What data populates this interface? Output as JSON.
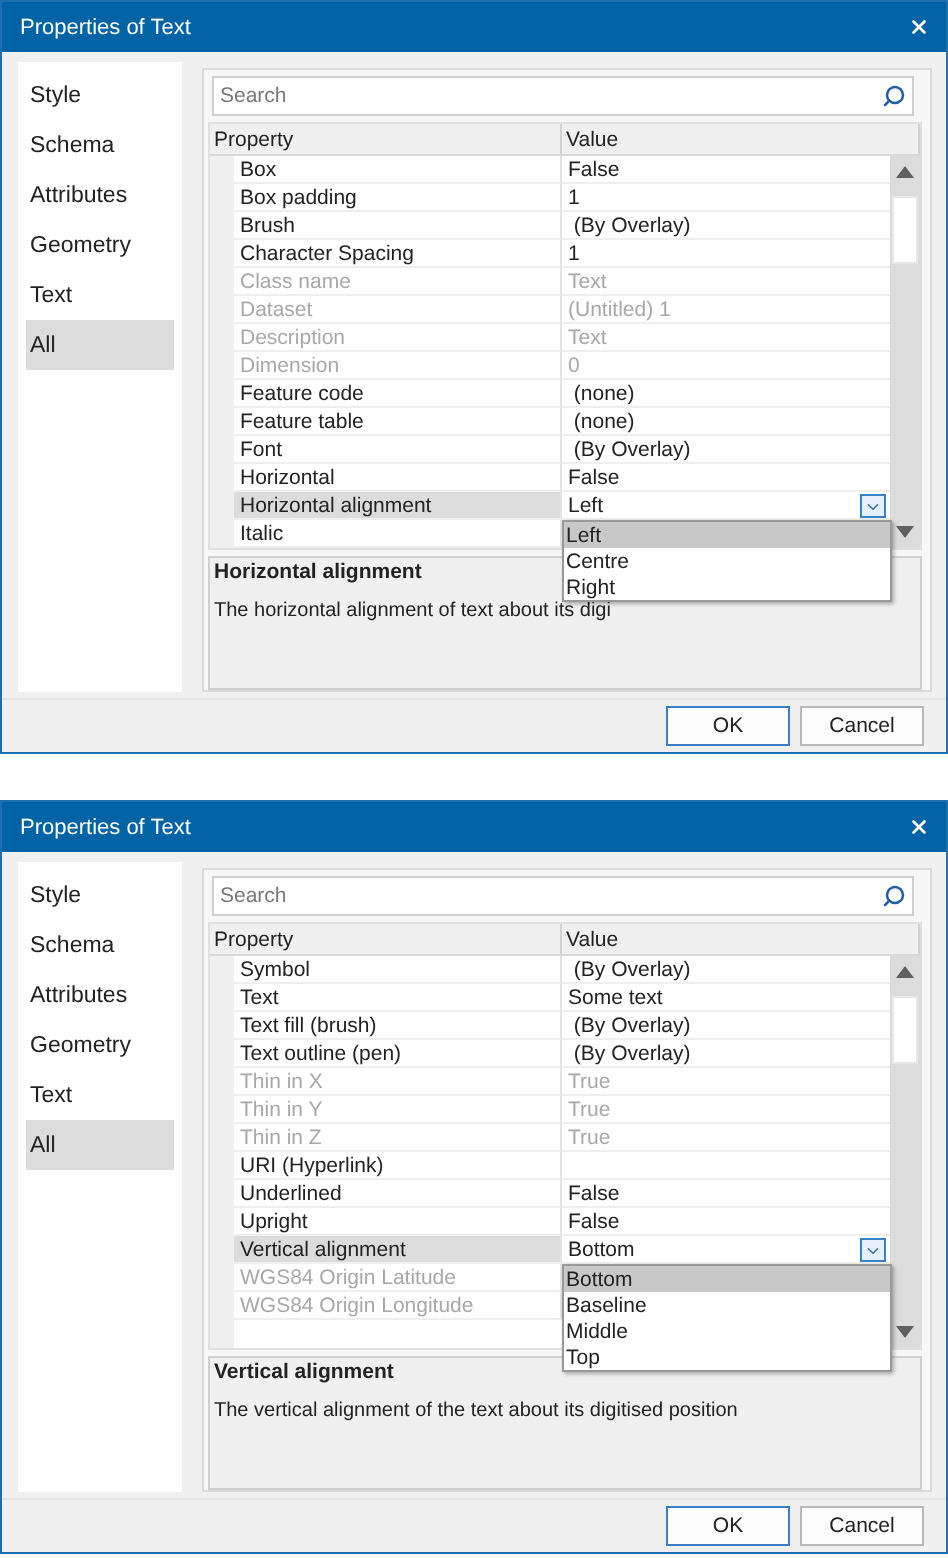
{
  "dialogs": [
    {
      "title": "Properties of Text",
      "tabs": [
        {
          "label": "Style",
          "selected": false
        },
        {
          "label": "Schema",
          "selected": false
        },
        {
          "label": "Attributes",
          "selected": false
        },
        {
          "label": "Geometry",
          "selected": false
        },
        {
          "label": "Text",
          "selected": false
        },
        {
          "label": "All",
          "selected": true
        }
      ],
      "search": {
        "placeholder": "Search"
      },
      "table": {
        "columns": [
          "Property",
          "Value"
        ],
        "rows": [
          {
            "property": "Box",
            "value": "False",
            "disabled": false,
            "selected": false
          },
          {
            "property": "Box padding",
            "value": "1",
            "disabled": false,
            "selected": false
          },
          {
            "property": "Brush",
            "value": " (By Overlay)",
            "disabled": false,
            "selected": false
          },
          {
            "property": "Character Spacing",
            "value": "1",
            "disabled": false,
            "selected": false
          },
          {
            "property": "Class name",
            "value": "Text",
            "disabled": true,
            "selected": false
          },
          {
            "property": "Dataset",
            "value": "(Untitled) 1",
            "disabled": true,
            "selected": false
          },
          {
            "property": "Description",
            "value": "Text",
            "disabled": true,
            "selected": false
          },
          {
            "property": "Dimension",
            "value": "0",
            "disabled": true,
            "selected": false
          },
          {
            "property": "Feature code",
            "value": " (none)",
            "disabled": false,
            "selected": false
          },
          {
            "property": "Feature table",
            "value": " (none)",
            "disabled": false,
            "selected": false
          },
          {
            "property": "Font",
            "value": " (By Overlay)",
            "disabled": false,
            "selected": false
          },
          {
            "property": "Horizontal",
            "value": "False",
            "disabled": false,
            "selected": false
          },
          {
            "property": "Horizontal alignment",
            "value": "Left",
            "disabled": false,
            "selected": true
          },
          {
            "property": "Italic",
            "value": "",
            "disabled": false,
            "selected": false
          }
        ]
      },
      "dropdown": {
        "items": [
          {
            "label": "Left",
            "selected": true
          },
          {
            "label": "Centre",
            "selected": false
          },
          {
            "label": "Right",
            "selected": false
          }
        ]
      },
      "description": {
        "title": "Horizontal alignment",
        "text": "The horizontal alignment of text about its digi"
      },
      "buttons": [
        {
          "label": "OK",
          "default": true
        },
        {
          "label": "Cancel",
          "default": false
        }
      ]
    },
    {
      "title": "Properties of Text",
      "tabs": [
        {
          "label": "Style",
          "selected": false
        },
        {
          "label": "Schema",
          "selected": false
        },
        {
          "label": "Attributes",
          "selected": false
        },
        {
          "label": "Geometry",
          "selected": false
        },
        {
          "label": "Text",
          "selected": false
        },
        {
          "label": "All",
          "selected": true
        }
      ],
      "search": {
        "placeholder": "Search"
      },
      "table": {
        "columns": [
          "Property",
          "Value"
        ],
        "rows": [
          {
            "property": "Symbol",
            "value": " (By Overlay)",
            "disabled": false,
            "selected": false
          },
          {
            "property": "Text",
            "value": "Some text",
            "disabled": false,
            "selected": false
          },
          {
            "property": "Text fill (brush)",
            "value": " (By Overlay)",
            "disabled": false,
            "selected": false
          },
          {
            "property": "Text outline (pen)",
            "value": " (By Overlay)",
            "disabled": false,
            "selected": false
          },
          {
            "property": "Thin in X",
            "value": "True",
            "disabled": true,
            "selected": false
          },
          {
            "property": "Thin in Y",
            "value": "True",
            "disabled": true,
            "selected": false
          },
          {
            "property": "Thin in Z",
            "value": "True",
            "disabled": true,
            "selected": false
          },
          {
            "property": "URI (Hyperlink)",
            "value": "",
            "disabled": false,
            "selected": false
          },
          {
            "property": "Underlined",
            "value": "False",
            "disabled": false,
            "selected": false
          },
          {
            "property": "Upright",
            "value": "False",
            "disabled": false,
            "selected": false
          },
          {
            "property": "Vertical alignment",
            "value": "Bottom",
            "disabled": false,
            "selected": true
          },
          {
            "property": "WGS84 Origin Latitude",
            "value": "",
            "disabled": true,
            "selected": false
          },
          {
            "property": "WGS84 Origin Longitude",
            "value": "",
            "disabled": true,
            "selected": false
          }
        ]
      },
      "dropdown": {
        "items": [
          {
            "label": "Bottom",
            "selected": true
          },
          {
            "label": "Baseline",
            "selected": false
          },
          {
            "label": "Middle",
            "selected": false
          },
          {
            "label": "Top",
            "selected": false
          }
        ]
      },
      "description": {
        "title": "Vertical alignment",
        "text": "The vertical alignment of the text about its digitised position"
      },
      "buttons": [
        {
          "label": "OK",
          "default": true
        },
        {
          "label": "Cancel",
          "default": false
        }
      ]
    }
  ]
}
